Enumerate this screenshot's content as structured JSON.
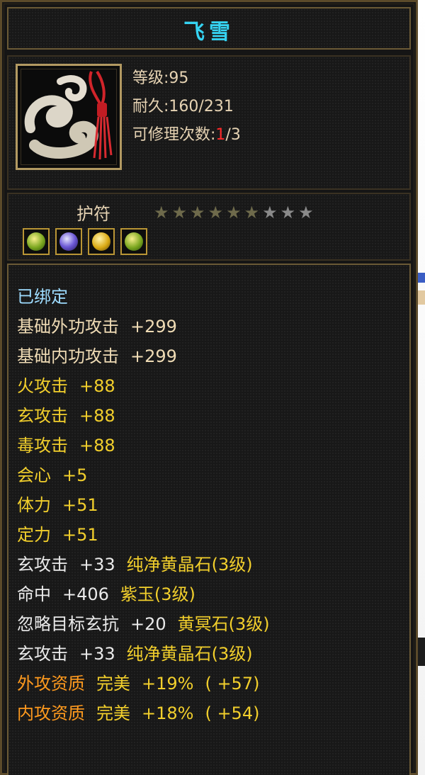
{
  "item": {
    "name": "飞雪",
    "level_text": "等级:95",
    "durability_label": "耐久:",
    "durability_value": "160/231",
    "repair_label": "可修理次数:",
    "repair_used": "1",
    "repair_total": "/3",
    "type": "护符",
    "stars_filled": 6,
    "stars_total": 9,
    "gem_slots": [
      {
        "icon": "green-yellow-gem-icon"
      },
      {
        "icon": "blue-purple-gem-icon"
      },
      {
        "icon": "yellow-crystal-gem-icon"
      },
      {
        "icon": "green-yellow-gem-icon"
      }
    ]
  },
  "attributes": [
    {
      "parts": [
        {
          "text": "已绑定",
          "color": "bound"
        }
      ]
    },
    {
      "parts": [
        {
          "text": "基础外功攻击",
          "color": "base"
        },
        {
          "text": "+299",
          "color": "base"
        }
      ]
    },
    {
      "parts": [
        {
          "text": "基础内功攻击",
          "color": "base"
        },
        {
          "text": "+299",
          "color": "base"
        }
      ]
    },
    {
      "parts": [
        {
          "text": "火攻击",
          "color": "yellow"
        },
        {
          "text": "+88",
          "color": "yellow"
        }
      ]
    },
    {
      "parts": [
        {
          "text": "玄攻击",
          "color": "yellow"
        },
        {
          "text": "+88",
          "color": "yellow"
        }
      ]
    },
    {
      "parts": [
        {
          "text": "毒攻击",
          "color": "yellow"
        },
        {
          "text": "+88",
          "color": "yellow"
        }
      ]
    },
    {
      "parts": [
        {
          "text": "会心",
          "color": "yellow"
        },
        {
          "text": "+5",
          "color": "yellow"
        }
      ]
    },
    {
      "parts": [
        {
          "text": "体力",
          "color": "yellow"
        },
        {
          "text": "+51",
          "color": "yellow"
        }
      ]
    },
    {
      "parts": [
        {
          "text": "定力",
          "color": "yellow"
        },
        {
          "text": "+51",
          "color": "yellow"
        }
      ]
    },
    {
      "parts": [
        {
          "text": "玄攻击",
          "color": "white"
        },
        {
          "text": "+33",
          "color": "white"
        },
        {
          "text": "纯净黄晶石(3级)",
          "color": "yellow"
        }
      ]
    },
    {
      "parts": [
        {
          "text": "命中",
          "color": "white"
        },
        {
          "text": "+406",
          "color": "white"
        },
        {
          "text": "紫玉(3级)",
          "color": "yellow"
        }
      ]
    },
    {
      "parts": [
        {
          "text": "忽略目标玄抗",
          "color": "white"
        },
        {
          "text": "+20",
          "color": "white"
        },
        {
          "text": "黄冥石(3级)",
          "color": "yellow"
        }
      ]
    },
    {
      "parts": [
        {
          "text": "玄攻击",
          "color": "white"
        },
        {
          "text": "+33",
          "color": "white"
        },
        {
          "text": "纯净黄晶石(3级)",
          "color": "yellow"
        }
      ]
    },
    {
      "parts": [
        {
          "text": "外攻资质",
          "color": "orange"
        },
        {
          "text": "完美",
          "color": "yellow"
        },
        {
          "text": "+19%",
          "color": "yellow"
        },
        {
          "text": "( +57)",
          "color": "yellow"
        }
      ]
    },
    {
      "parts": [
        {
          "text": "内攻资质",
          "color": "orange"
        },
        {
          "text": "完美",
          "color": "yellow"
        },
        {
          "text": "+18%",
          "color": "yellow"
        },
        {
          "text": "( +54)",
          "color": "yellow"
        }
      ]
    }
  ],
  "colors": {
    "title": "#35d3f2",
    "bound": "#9edcff",
    "base": "#f0dcb5",
    "yellow": "#f2cf2c",
    "white": "#eaeaea",
    "orange": "#ff9a1e",
    "repair_used": "#ff2a2a",
    "frame": "#6b5a36"
  }
}
